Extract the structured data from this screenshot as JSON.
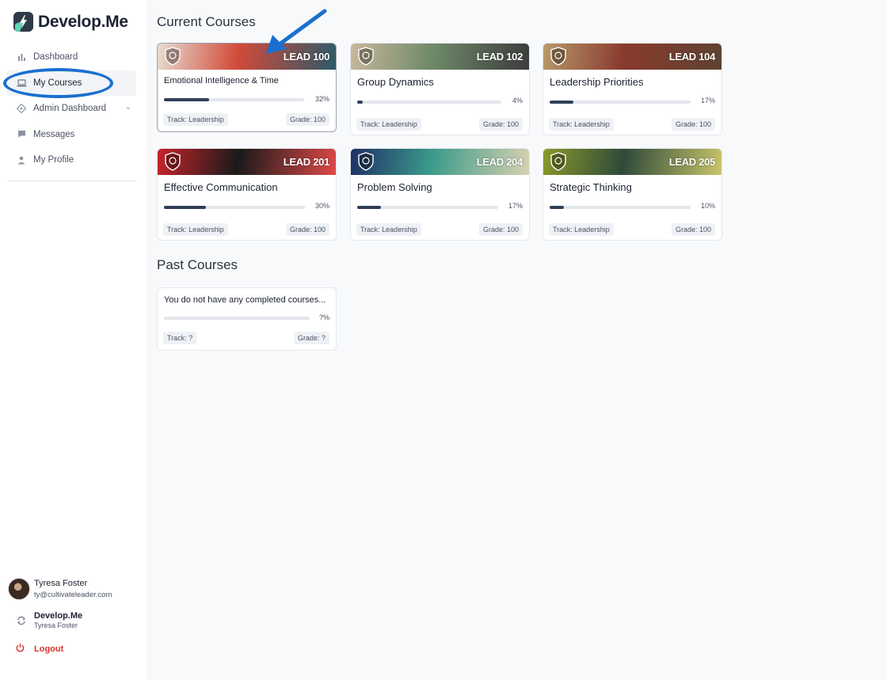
{
  "app": {
    "name": "Develop.Me"
  },
  "sidebar": {
    "items": [
      {
        "label": "Dashboard",
        "icon": "bar-chart-icon"
      },
      {
        "label": "My Courses",
        "icon": "laptop-icon",
        "active": true
      },
      {
        "label": "Admin Dashboard",
        "icon": "diamond-nav-icon",
        "has_children": true
      },
      {
        "label": "Messages",
        "icon": "chat-icon"
      },
      {
        "label": "My Profile",
        "icon": "user-icon"
      }
    ],
    "user": {
      "name": "Tyresa Foster",
      "email": "ty@cultivateleader.com"
    },
    "org": {
      "name": "Develop.Me",
      "sub": "Tyresa Foster"
    },
    "logout_label": "Logout"
  },
  "current": {
    "title": "Current Courses",
    "courses": [
      {
        "code": "LEAD 100",
        "title": "Emotional Intelligence & Time",
        "progress": 32,
        "progress_label": "32%",
        "track": "Track: Leadership",
        "grade": "Grade: 100",
        "banner_colors": [
          "#e8ded2",
          "#d14a3a",
          "#2c5a6a"
        ]
      },
      {
        "code": "LEAD 102",
        "title": "Group Dynamics",
        "progress": 4,
        "progress_label": "4%",
        "track": "Track: Leadership",
        "grade": "Grade: 100",
        "banner_colors": [
          "#c9b89c",
          "#6f8a6a",
          "#3c3c3c"
        ]
      },
      {
        "code": "LEAD 104",
        "title": "Leadership Priorities",
        "progress": 17,
        "progress_label": "17%",
        "track": "Track: Leadership",
        "grade": "Grade: 100",
        "banner_colors": [
          "#b89a6b",
          "#8a3a2e",
          "#5c4330"
        ]
      },
      {
        "code": "LEAD 201",
        "title": "Effective Communication",
        "progress": 30,
        "progress_label": "30%",
        "track": "Track: Leadership",
        "grade": "Grade: 100",
        "banner_colors": [
          "#c8242a",
          "#1a1a1a",
          "#e04848"
        ]
      },
      {
        "code": "LEAD 204",
        "title": "Problem Solving",
        "progress": 17,
        "progress_label": "17%",
        "track": "Track: Leadership",
        "grade": "Grade: 100",
        "banner_colors": [
          "#1f2f66",
          "#3a9a8a",
          "#d9d2b0"
        ]
      },
      {
        "code": "LEAD 205",
        "title": "Strategic Thinking",
        "progress": 10,
        "progress_label": "10%",
        "track": "Track: Leadership",
        "grade": "Grade: 100",
        "banner_colors": [
          "#8a9a2a",
          "#2f4a3a",
          "#c9c66a"
        ]
      }
    ]
  },
  "past": {
    "title": "Past Courses",
    "empty": {
      "title": "You do not have any completed courses...",
      "progress_label": "?%",
      "track": "Track: ?",
      "grade": "Grade: ?"
    }
  },
  "annotation": {
    "color": "#1a6fcf"
  }
}
